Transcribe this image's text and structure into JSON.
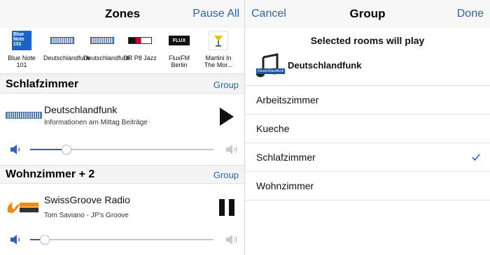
{
  "colors": {
    "accent": "#2a63b8",
    "separator": "#e2e2e2"
  },
  "zones": {
    "title": "Zones",
    "pause_all": "Pause All",
    "stations": [
      {
        "name": "Blue Note 101",
        "logo_text": "Blue Note 101",
        "icon": "blue-note-logo"
      },
      {
        "name": "Deutschlandfunk",
        "icon": "deutschlandfunk-logo"
      },
      {
        "name": "Deutschlandfunk",
        "icon": "deutschlandfunk-logo"
      },
      {
        "name": "DR P8 Jazz",
        "icon": "dr-p8-logo"
      },
      {
        "name": "FluxFM Berlin",
        "logo_text": "FLUX",
        "icon": "fluxfm-logo"
      },
      {
        "name": "Martini In The Mor...",
        "icon": "martini-logo"
      }
    ],
    "groups": [
      {
        "title": "Schlafzimmer",
        "action": "Group",
        "station": "Deutschlandfunk",
        "track": "Informationen am Mittag Beiträge",
        "state": "playing",
        "control_icon": "play-icon",
        "volume": 0.2
      },
      {
        "title": "Wohnzimmer + 2",
        "action": "Group",
        "station": "SwissGroove Radio",
        "track": "Tom Saviano - JP's Groove",
        "state": "paused",
        "control_icon": "pause-icon",
        "volume": 0.08
      }
    ]
  },
  "group": {
    "title": "Group",
    "cancel": "Cancel",
    "done": "Done",
    "info": "Selected rooms will play",
    "station": "Deutschlandfunk",
    "art_label": "Deutschlandfunk",
    "rooms": [
      {
        "name": "Arbeitszimmer",
        "checked": false
      },
      {
        "name": "Kueche",
        "checked": false
      },
      {
        "name": "Schlafzimmer",
        "checked": true
      },
      {
        "name": "Wohnzimmer",
        "checked": false
      }
    ]
  }
}
